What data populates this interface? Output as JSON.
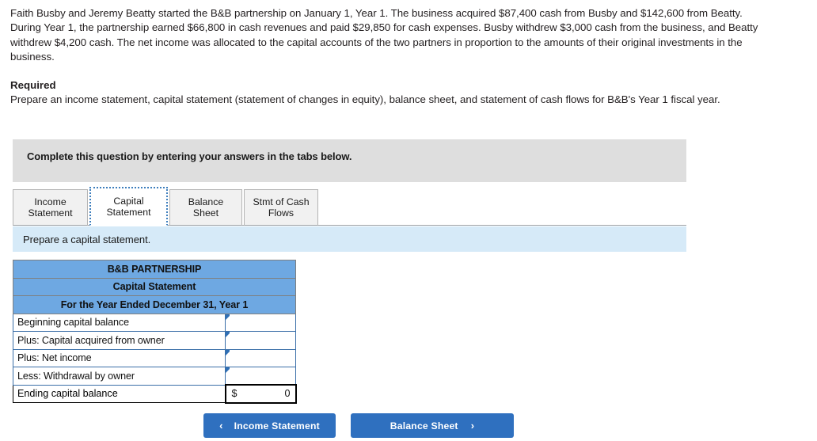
{
  "problem": {
    "statement": "Faith Busby and Jeremy Beatty started the B&B partnership on January 1, Year 1. The business acquired $87,400 cash from Busby and $142,600 from Beatty. During Year 1, the partnership earned $66,800 in cash revenues and paid $29,850 for cash expenses. Busby withdrew $3,000 cash from the business, and Beatty withdrew $4,200 cash. The net income was allocated to the capital accounts of the two partners in proportion to the amounts of their original investments in the business."
  },
  "required": {
    "heading": "Required",
    "text": "Prepare an income statement, capital statement (statement of changes in equity), balance sheet, and statement of cash flows for B&B's Year 1 fiscal year."
  },
  "banner": {
    "text": "Complete this question by entering your answers in the tabs below."
  },
  "tabs": [
    {
      "label": "Income\nStatement",
      "name": "tab-income-statement",
      "active": false
    },
    {
      "label": "Capital\nStatement",
      "name": "tab-capital-statement",
      "active": true
    },
    {
      "label": "Balance Sheet",
      "name": "tab-balance-sheet",
      "active": false
    },
    {
      "label": "Stmt of Cash\nFlows",
      "name": "tab-stmt-cash-flows",
      "active": false
    }
  ],
  "prompt": {
    "text": "Prepare a capital statement."
  },
  "statement_table": {
    "titles": [
      "B&B PARTNERSHIP",
      "Capital Statement",
      "For the Year Ended December 31, Year 1"
    ],
    "rows": [
      {
        "label": "Beginning capital balance",
        "value": "",
        "marker": false
      },
      {
        "label": "Plus: Capital acquired from owner",
        "value": "",
        "marker": true
      },
      {
        "label": "Plus: Net income",
        "value": "",
        "marker": true
      },
      {
        "label": "Less: Withdrawal by owner",
        "value": "",
        "marker": true
      }
    ],
    "total_row": {
      "label": "Ending capital balance",
      "currency": "$",
      "value": "0"
    }
  },
  "nav": {
    "prev": {
      "label": "Income Statement",
      "chevron": "‹"
    },
    "next": {
      "label": "Balance Sheet",
      "chevron": "›"
    }
  },
  "colors": {
    "table_header_blue": "#6ea8e2",
    "button_blue": "#2f70bf",
    "banner_gray": "#dedede",
    "prompt_blue": "#d6eaf8",
    "cell_border_blue": "#3b6fa8"
  }
}
